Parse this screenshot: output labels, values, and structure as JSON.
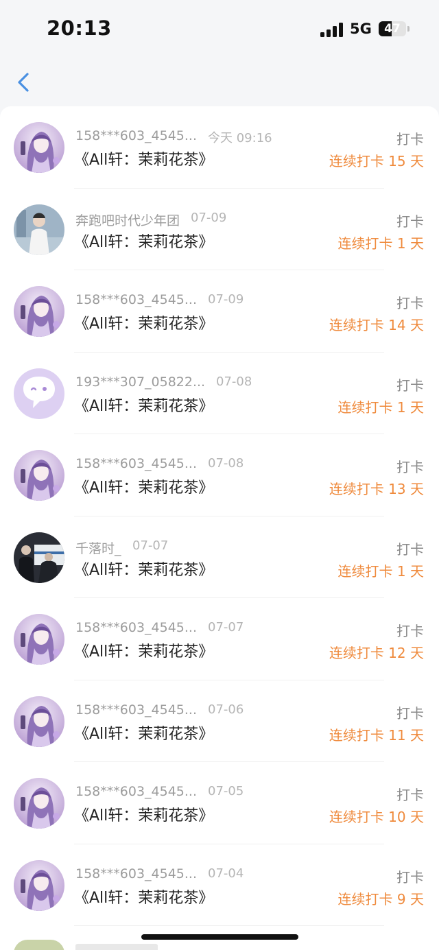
{
  "status_bar": {
    "time": "20:13",
    "network": "5G",
    "battery": "47",
    "battery_level": 0.47
  },
  "nav": {
    "back_icon": "chevron-left-icon"
  },
  "colors": {
    "accent": "#4a90e2",
    "streak": "#ef8a3c"
  },
  "records": [
    {
      "user": "158***603_4545...",
      "date": "今天 09:16",
      "content": "《All轩：茉莉花茶》",
      "type": "打卡",
      "streak": "连续打卡 15 天",
      "avatar": "anime-girl"
    },
    {
      "user": "奔跑吧时代少年团",
      "date": "07-09",
      "content": "《All轩：茉莉花茶》",
      "type": "打卡",
      "streak": "连续打卡 1 天",
      "avatar": "photo-person"
    },
    {
      "user": "158***603_4545...",
      "date": "07-09",
      "content": "《All轩：茉莉花茶》",
      "type": "打卡",
      "streak": "连续打卡 14 天",
      "avatar": "anime-girl"
    },
    {
      "user": "193***307_05822...",
      "date": "07-08",
      "content": "《All轩：茉莉花茶》",
      "type": "打卡",
      "streak": "连续打卡 1 天",
      "avatar": "default-chat"
    },
    {
      "user": "158***603_4545...",
      "date": "07-08",
      "content": "《All轩：茉莉花茶》",
      "type": "打卡",
      "streak": "连续打卡 13 天",
      "avatar": "anime-girl"
    },
    {
      "user": "千落时_",
      "date": "07-07",
      "content": "《All轩：茉莉花茶》",
      "type": "打卡",
      "streak": "连续打卡 1 天",
      "avatar": "photo-dark"
    },
    {
      "user": "158***603_4545...",
      "date": "07-07",
      "content": "《All轩：茉莉花茶》",
      "type": "打卡",
      "streak": "连续打卡 12 天",
      "avatar": "anime-girl"
    },
    {
      "user": "158***603_4545...",
      "date": "07-06",
      "content": "《All轩：茉莉花茶》",
      "type": "打卡",
      "streak": "连续打卡 11 天",
      "avatar": "anime-girl"
    },
    {
      "user": "158***603_4545...",
      "date": "07-05",
      "content": "《All轩：茉莉花茶》",
      "type": "打卡",
      "streak": "连续打卡 10 天",
      "avatar": "anime-girl"
    },
    {
      "user": "158***603_4545...",
      "date": "07-04",
      "content": "《All轩：茉莉花茶》",
      "type": "打卡",
      "streak": "连续打卡 9 天",
      "avatar": "anime-girl"
    }
  ]
}
